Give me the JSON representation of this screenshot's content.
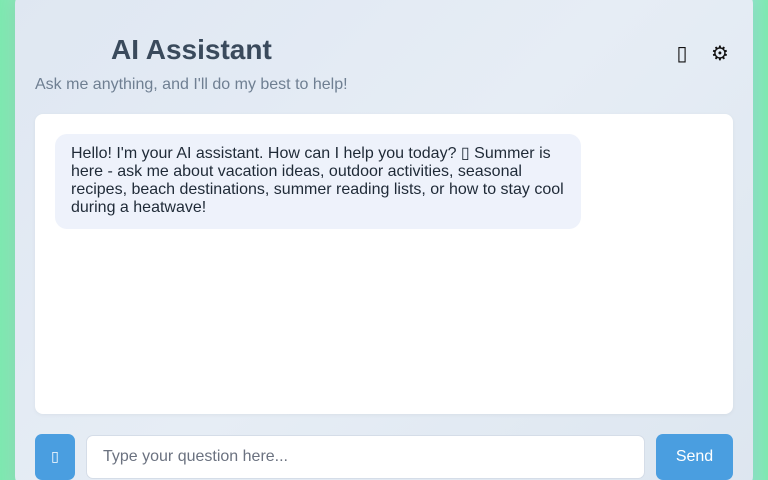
{
  "header": {
    "title": "AI Assistant",
    "subtitle": "Ask me anything, and I'll do my best to help!",
    "theme_toggle_icon": "theme-toggle-icon",
    "theme_toggle_glyph": "▯",
    "settings_icon": "gear-icon",
    "settings_glyph": "⚙"
  },
  "chat": {
    "messages": [
      {
        "role": "assistant",
        "text": "Hello! I'm your AI assistant. How can I help you today? ▯ Summer is here - ask me about vacation ideas, outdoor activities, seasonal recipes, beach destinations, summer reading lists, or how to stay cool during a heatwave!"
      }
    ]
  },
  "input": {
    "mic_icon": "microphone-icon",
    "mic_glyph": "▯",
    "placeholder": "Type your question here...",
    "value": "",
    "send_label": "Send"
  },
  "colors": {
    "accent": "#4a9ee0",
    "bubble_bg": "#eef2fb",
    "title": "#3a4a5c",
    "subtitle": "#6f7f92"
  }
}
